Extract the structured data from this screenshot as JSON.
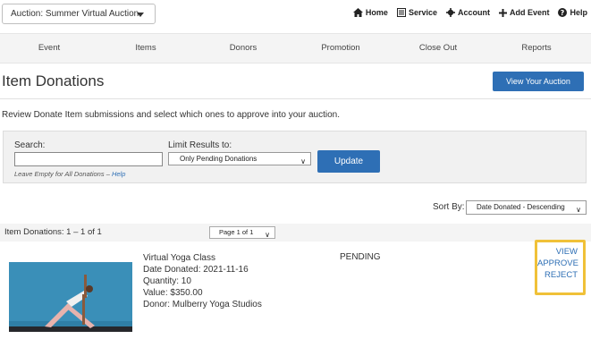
{
  "topbar": {
    "auction_selector": "Auction: Summer Virtual Auction",
    "links": {
      "home": "Home",
      "service": "Service",
      "account": "Account",
      "add_event": "Add Event",
      "help": "Help"
    },
    "icons": {
      "home": "home-icon",
      "service": "clipboard-icon",
      "account": "gear-icon",
      "add_event": "plus-icon",
      "help": "question-circle-icon"
    }
  },
  "nav": {
    "event": "Event",
    "items": "Items",
    "donors": "Donors",
    "promotion": "Promotion",
    "close_out": "Close Out",
    "reports": "Reports"
  },
  "page": {
    "title": "Item Donations",
    "view_auction_button": "View Your Auction",
    "intro": "Review Donate Item submissions and select which ones to approve into your auction."
  },
  "filters": {
    "search_label": "Search:",
    "search_value": "",
    "search_hint": "Leave Empty for All Donations – ",
    "search_hint_link": "Help",
    "limit_label": "Limit Results to:",
    "limit_value": "Only Pending Donations",
    "update_button": "Update"
  },
  "sort": {
    "label": "Sort By:",
    "value": "Date Donated - Descending"
  },
  "results": {
    "count_text": "Item Donations: 1 – 1 of 1",
    "page_value": "Page 1 of 1"
  },
  "items": [
    {
      "name": "Virtual Yoga Class",
      "date_donated": "Date Donated: 2021-11-16",
      "quantity": "Quantity: 10",
      "value": "Value: $350.00",
      "donor": "Donor: Mulberry Yoga Studios",
      "status": "PENDING",
      "actions": {
        "view": "VIEW",
        "approve": "APPROVE",
        "reject": "REJECT"
      }
    }
  ],
  "colors": {
    "primary_button": "#2e6fb5",
    "link": "#2e6fb5",
    "highlight_border": "#f0c138",
    "nav_background": "#f4f4f4",
    "photo_background": "#3a8fb8"
  }
}
